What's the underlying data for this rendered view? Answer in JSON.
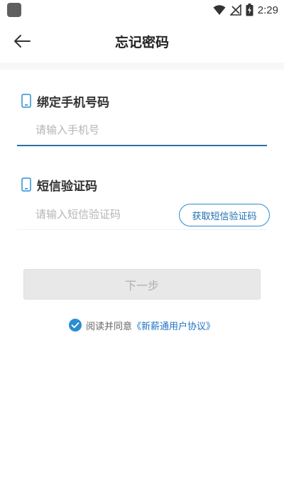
{
  "status_bar": {
    "time": "2:29",
    "icons": [
      "app-icon",
      "wifi-icon",
      "no-signal-icon",
      "battery-charging-icon"
    ]
  },
  "header": {
    "title": "忘记密码",
    "back_icon": "arrow-left-icon"
  },
  "phone_section": {
    "label": "绑定手机号码",
    "icon": "phone-icon",
    "placeholder": "请输入手机号",
    "value": ""
  },
  "code_section": {
    "label": "短信验证码",
    "icon": "phone-icon",
    "placeholder": "请输入短信验证码",
    "value": "",
    "get_code_label": "获取短信验证码"
  },
  "next_button": {
    "label": "下一步",
    "enabled": false
  },
  "agreement": {
    "checked": true,
    "text": "阅读并同意",
    "link": "《新薪通用户协议》"
  },
  "colors": {
    "accent": "#2a8dd4",
    "link": "#1f72c4",
    "input_underline": "#2a6fa3",
    "disabled_button": "#e8e8e8"
  }
}
